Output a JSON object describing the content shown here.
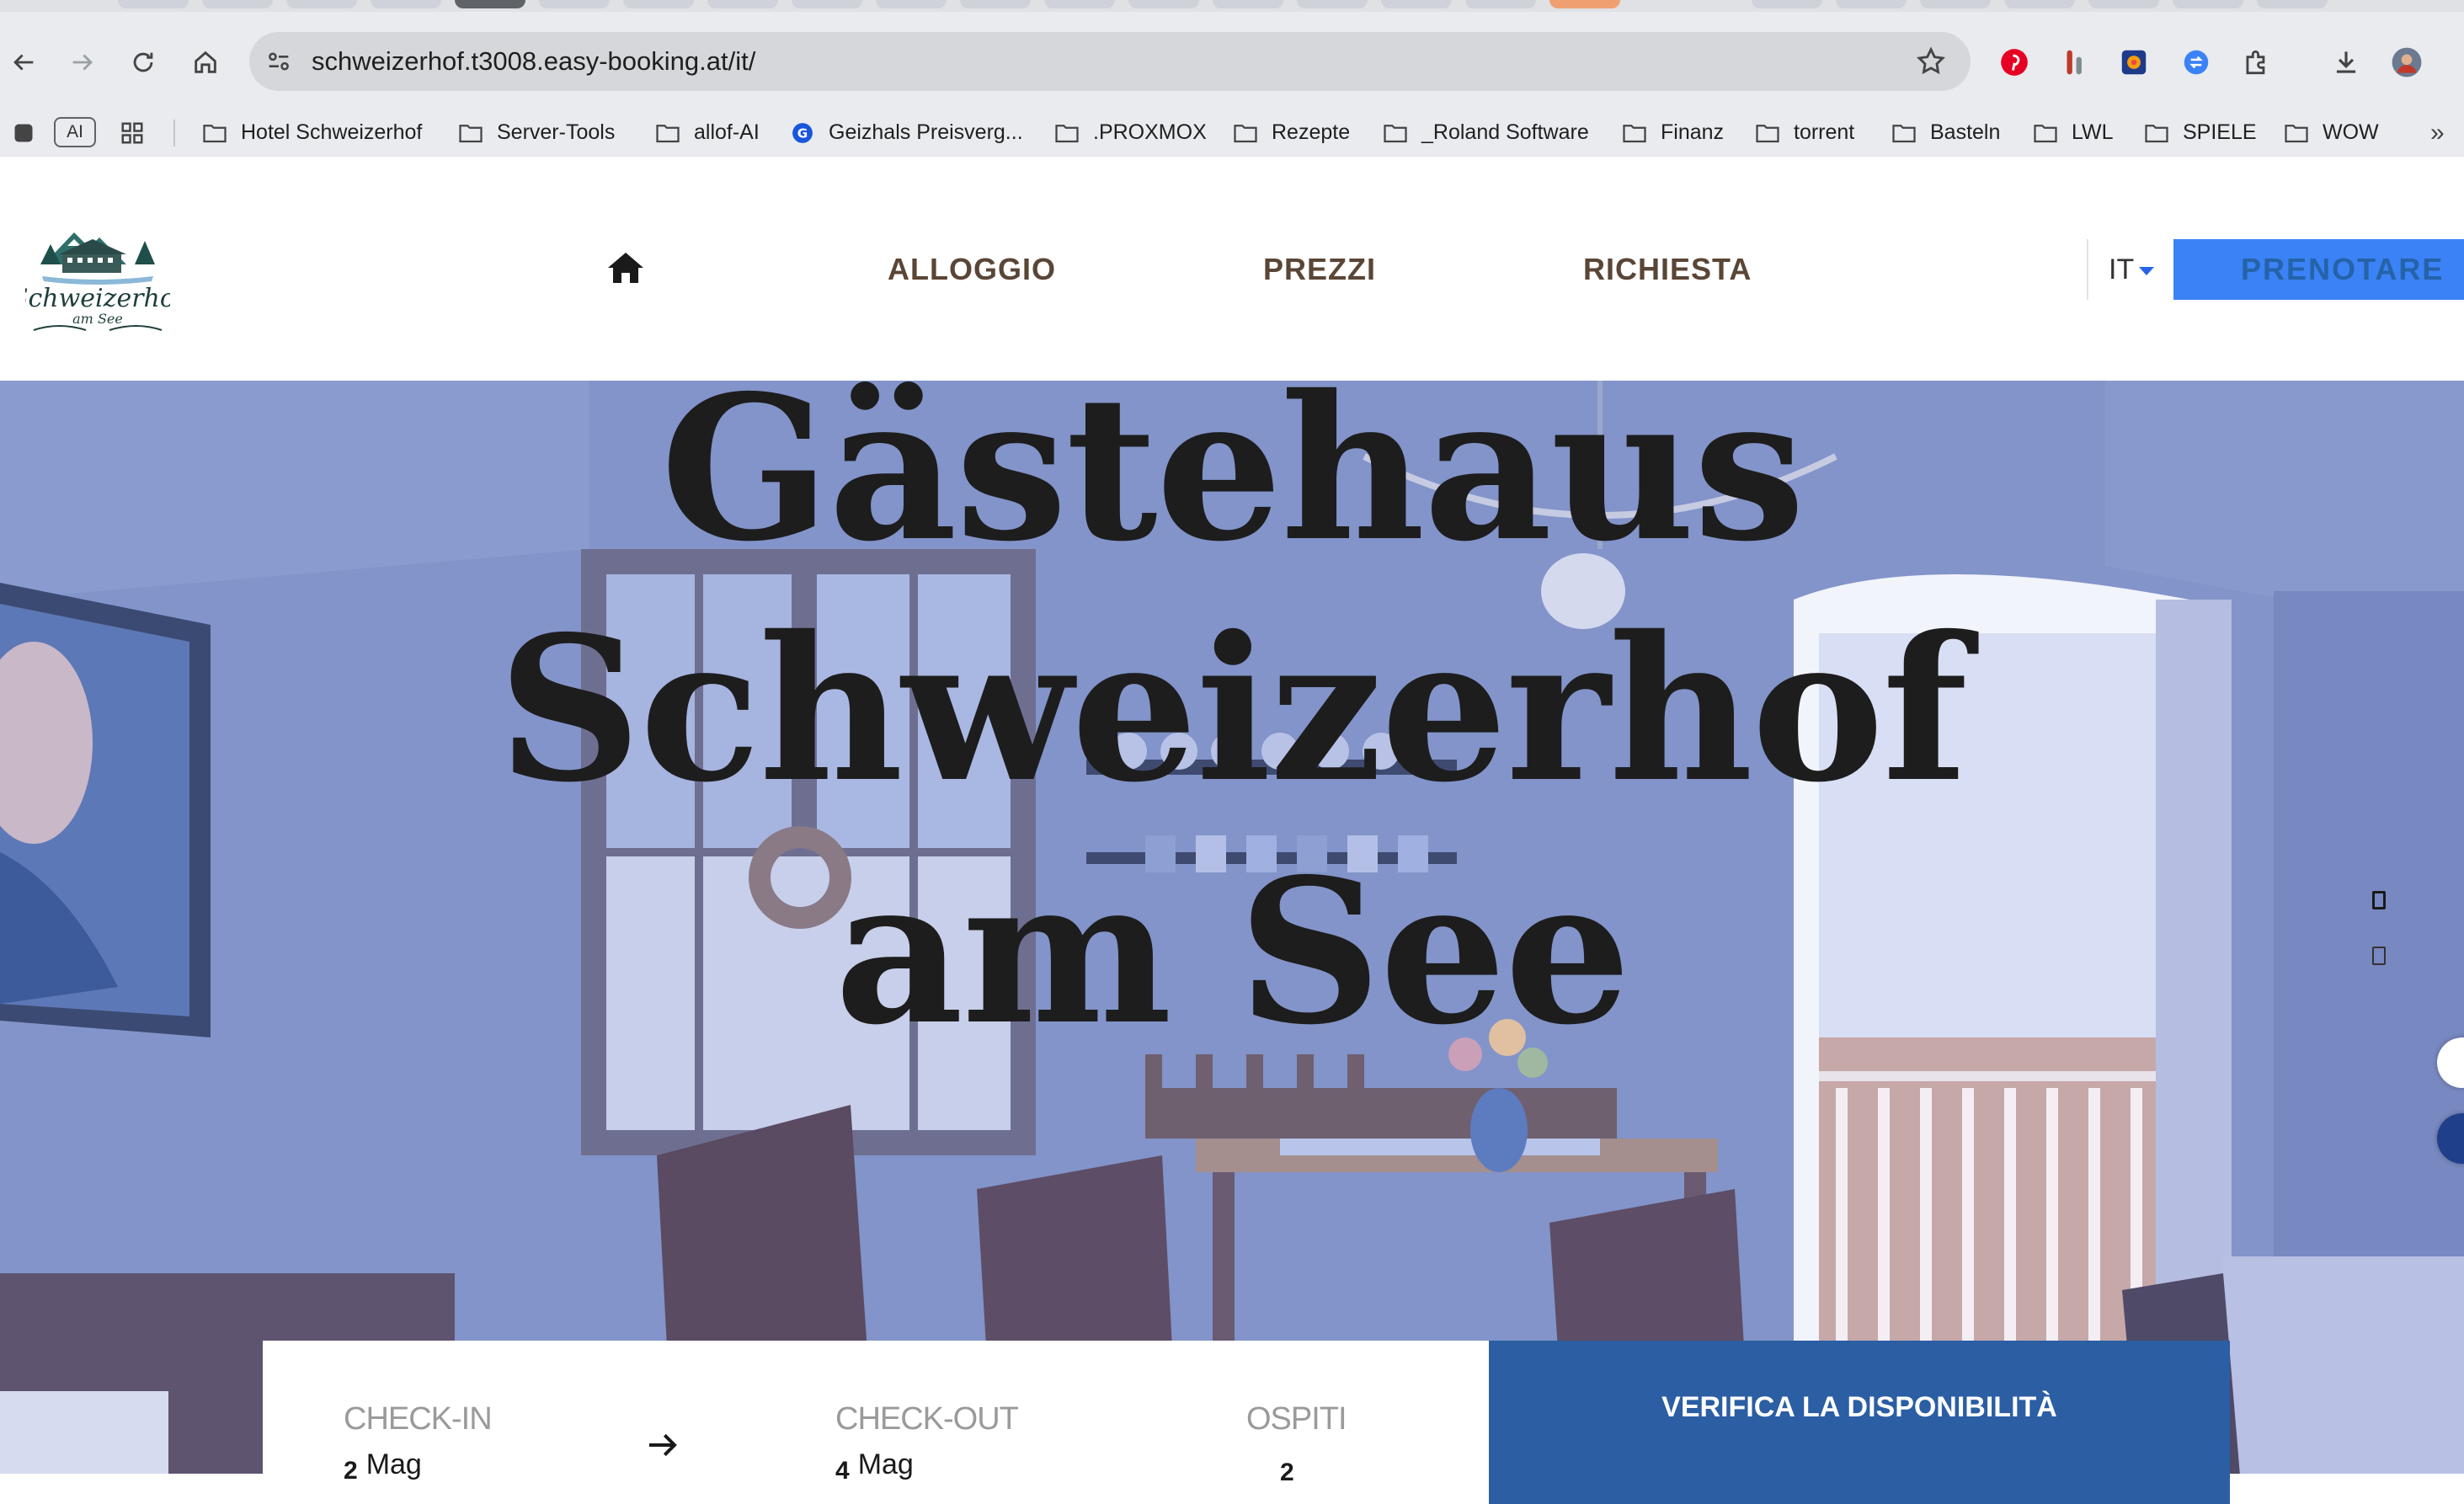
{
  "browser": {
    "url": "schweizerhof.t3008.easy-booking.at/it/",
    "bookmarks": [
      "Hotel Schweizerhof",
      "Server-Tools",
      "allof-AI",
      "Geizhals Preisverg...",
      ".PROXMOX",
      "Rezepte",
      "_Roland Software",
      "Finanz",
      "torrent",
      "Basteln",
      "LWL",
      "SPIELE",
      "WOW"
    ],
    "ai_label": "AI",
    "more_label": "»"
  },
  "site": {
    "logo_text": "Schweizerhof",
    "logo_subtext": "am See",
    "nav": {
      "alloggio": "ALLOGGIO",
      "prezzi": "PREZZI",
      "richiesta": "RICHIESTA"
    },
    "language": "IT",
    "book_button": "PRENOTARE"
  },
  "hero": {
    "title_line1": "Gästehaus",
    "title_line2": "Schweizerhof",
    "title_line3": "am See"
  },
  "booking": {
    "checkin_label": "CHECK-IN",
    "checkin_day": "2",
    "checkin_month": "Mag",
    "checkout_label": "CHECK-OUT",
    "checkout_day": "4",
    "checkout_month": "Mag",
    "guests_label": "OSPITI",
    "guests_value": "2",
    "verify_button": "VERIFICA LA DISPONIBILITÀ"
  },
  "colors": {
    "brand_brown": "#5a4636",
    "book_button_bg": "#3b82f6",
    "verify_bg": "#2b5ea3",
    "hero_overlay": "#7d90c8"
  }
}
